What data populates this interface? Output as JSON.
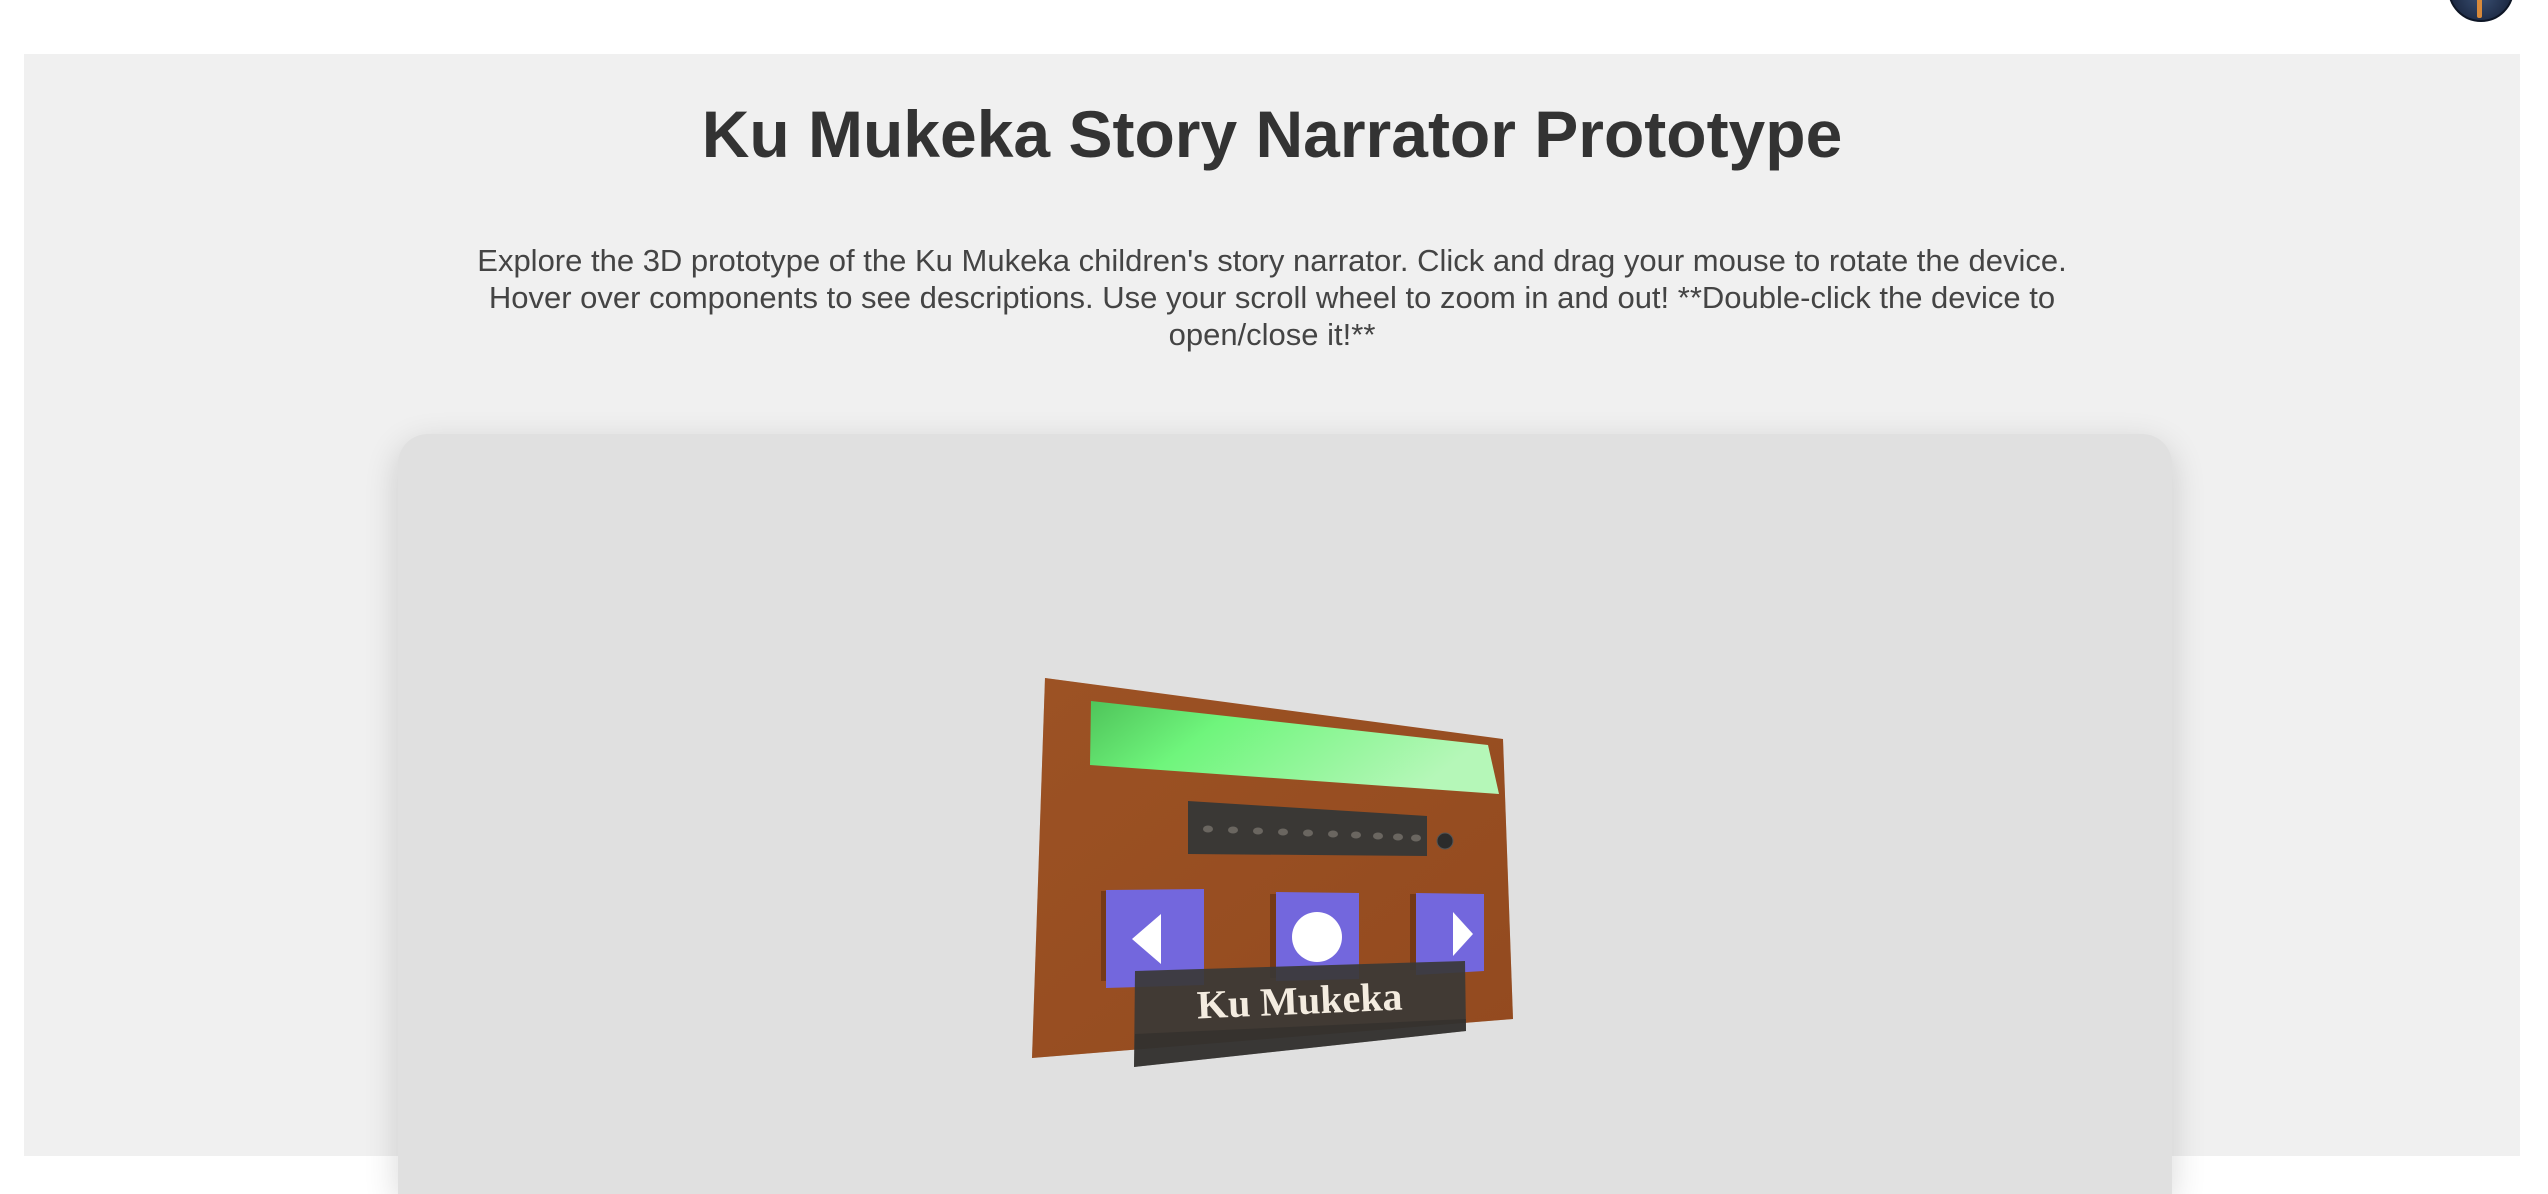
{
  "header": {
    "avatar_icon": "user-avatar-icon"
  },
  "main": {
    "title": "Ku Mukeka Story Narrator Prototype",
    "description": "Explore the 3D prototype of the Ku Mukeka children's story narrator. Click and drag your mouse to rotate the device. Hover over components to see descriptions. Use your scroll wheel to zoom in and out! **Double-click the device to open/close it!**"
  },
  "device": {
    "brand_label": "Ku Mukeka",
    "colors": {
      "body": "#9a4f22",
      "screen": "#6fea7c",
      "buttons": "#7367dd",
      "speaker": "#3b3b3b",
      "label_plate": "#3a3a3a",
      "viewer_background": "#e0e0e0",
      "page_background": "#f0f0f0"
    },
    "buttons": [
      {
        "name": "previous",
        "icon": "triangle-left-icon"
      },
      {
        "name": "play",
        "icon": "circle-icon"
      },
      {
        "name": "next",
        "icon": "triangle-right-icon"
      }
    ]
  }
}
